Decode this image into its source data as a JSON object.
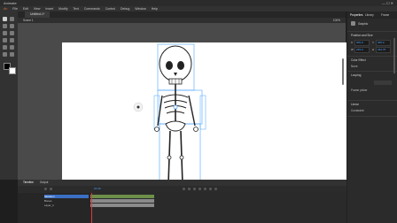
{
  "app": {
    "title": "Animate"
  },
  "menu": [
    "File",
    "Edit",
    "View",
    "Insert",
    "Modify",
    "Text",
    "Commands",
    "Control",
    "Debug",
    "Window",
    "Help"
  ],
  "document": {
    "tab": "Untitled-1*",
    "scene": "Scene 1",
    "zoom": "100%"
  },
  "properties": {
    "tabs": [
      "Properties",
      "Library",
      "Frame"
    ],
    "object_type": "Graphic",
    "sections": {
      "position_size": "Position and Size",
      "color_effect": "Color Effect",
      "looping": "Looping",
      "frame_picker": "Frame picker",
      "linear": "Linear",
      "constraint": "Constraint",
      "color_mode": "None",
      "x_label": "X",
      "y_label": "Y",
      "w_label": "W",
      "h_label": "H"
    },
    "values": {
      "x": "305.0",
      "y": "305.0",
      "w": "235.0",
      "h": "342.75"
    }
  },
  "timeline": {
    "tabs": [
      "Timeline",
      "Output"
    ],
    "fps": "24.00",
    "layers": [
      "Skeleton",
      "Bones",
      "Layer_1"
    ]
  },
  "colors": {
    "accent": "#4aa3ff",
    "stage": "#ffffff",
    "frame_grey": "#8a8a8a",
    "frame_green": "#6e8f4a"
  }
}
